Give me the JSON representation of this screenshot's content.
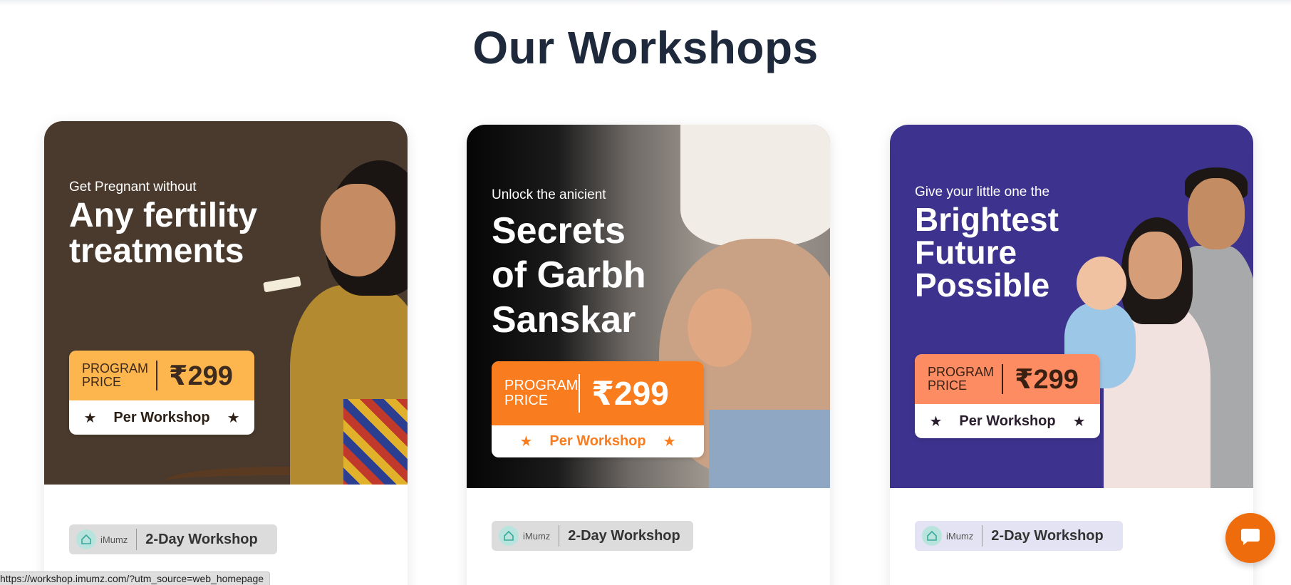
{
  "section": {
    "title": "Our Workshops"
  },
  "cards": [
    {
      "eyebrow": "Get Pregnant without",
      "headline_1": "Any fertility",
      "headline_2": "treatments",
      "price_label_1": "PROGRAM",
      "price_label_2": "PRICE",
      "price": "₹299",
      "per": "Per Workshop",
      "brand": "iMumz",
      "badge": "2-Day Workshop",
      "accent": "#fdb54e"
    },
    {
      "eyebrow": "Unlock the anicient",
      "headline_1": "Secrets",
      "headline_2": "of Garbh",
      "headline_3": "Sanskar",
      "price_label_1": "PROGRAM",
      "price_label_2": "PRICE",
      "price": "₹299",
      "per": "Per Workshop",
      "brand": "iMumz",
      "badge": "2-Day Workshop",
      "accent": "#f97d1f"
    },
    {
      "eyebrow": "Give your little one the",
      "headline_1": "Brightest",
      "headline_2": "Future",
      "headline_3": "Possible",
      "price_label_1": "PROGRAM",
      "price_label_2": "PRICE",
      "price": "₹299",
      "per": "Per Workshop",
      "brand": "iMumz",
      "badge": "2-Day Workshop",
      "accent": "#fe8c63"
    }
  ],
  "chat": {
    "icon": "chat-bubble-icon",
    "color": "#ef6c0d"
  },
  "status_bar": {
    "url": "https://workshop.imumz.com/?utm_source=web_homepage"
  }
}
